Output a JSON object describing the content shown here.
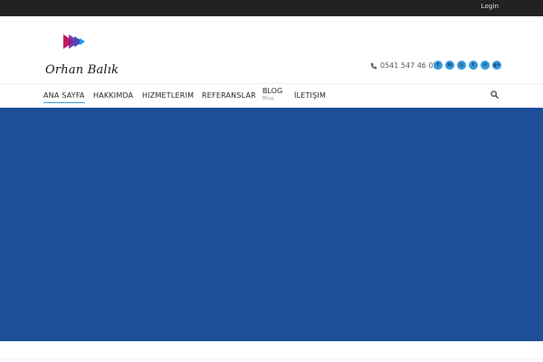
{
  "topbar": {
    "login": "Login"
  },
  "header": {
    "logo_text": "Orhan Balık",
    "phone": "0541 547 46 05",
    "social": [
      {
        "icon": "facebook-icon",
        "glyph": "f"
      },
      {
        "icon": "linkedin-icon",
        "glyph": "in"
      },
      {
        "icon": "instagram-icon",
        "glyph": "◎"
      },
      {
        "icon": "twitter-icon",
        "glyph": "t"
      },
      {
        "icon": "email-icon",
        "glyph": "✉"
      },
      {
        "icon": "google-plus-icon",
        "glyph": "g+"
      }
    ]
  },
  "nav": {
    "items": [
      {
        "label": "ANA SAYFA",
        "active": true
      },
      {
        "label": "HAKKIMDA"
      },
      {
        "label": "HIZMETLERIM"
      },
      {
        "label": "REFERANSLAR"
      },
      {
        "label": "BLOG",
        "sub": "Blog"
      },
      {
        "label": "İLETIŞIM"
      }
    ]
  },
  "colors": {
    "topbar": "#222222",
    "accent": "#3498db",
    "hero": "#1c4f97"
  }
}
